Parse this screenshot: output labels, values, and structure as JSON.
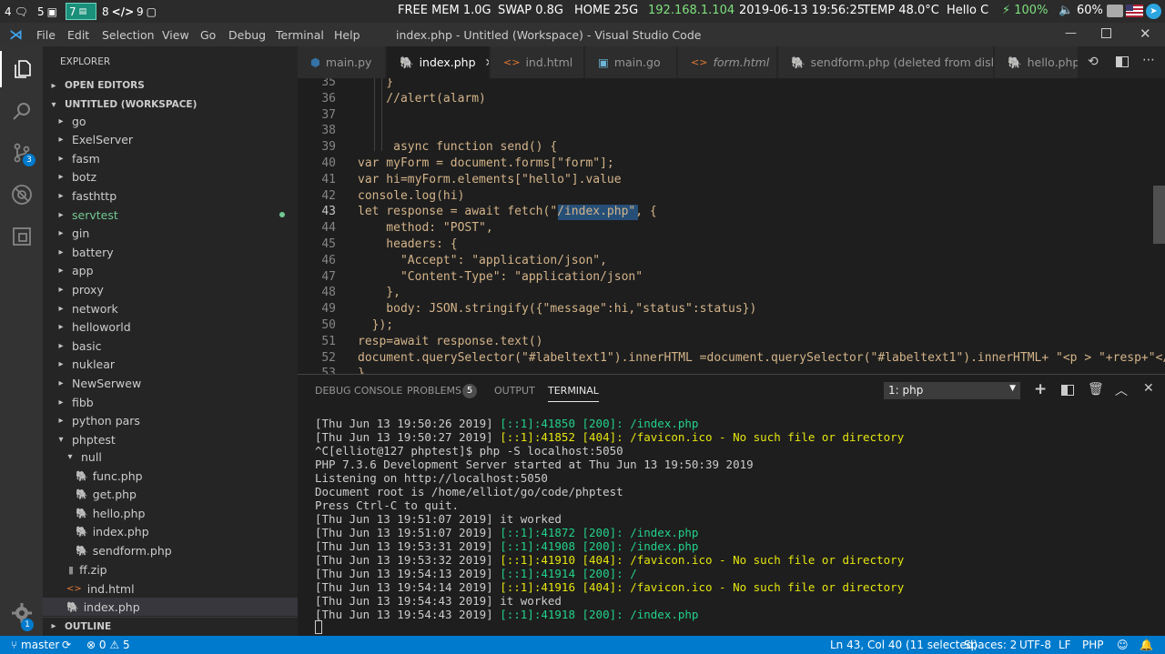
{
  "sysbar": {
    "workspaces": [
      "4",
      "5",
      "7",
      "8",
      "9"
    ],
    "free_mem": "FREE MEM 1.0G",
    "swap": "SWAP 0.8G",
    "home": "HOME 25G",
    "ip": "192.168.1.104",
    "datetime": "2019-06-13 19:56:25",
    "temp": "TEMP 48.0°C",
    "user": "Hello C",
    "battery": "⚡ 100%",
    "volume": "60%"
  },
  "titlebar": {
    "title": "index.php - Untitled (Workspace) - Visual Studio Code",
    "menu": [
      "File",
      "Edit",
      "Selection",
      "View",
      "Go",
      "Debug",
      "Terminal",
      "Help"
    ]
  },
  "activity": {
    "scm_badge": "3",
    "settings_badge": "1"
  },
  "sidebar": {
    "header": "EXPLORER",
    "open_editors": "OPEN EDITORS",
    "workspace": "UNTITLED (WORKSPACE)",
    "folders": [
      "go",
      "ExelServer",
      "fasm",
      "botz",
      "fasthttp",
      "servtest",
      "gin",
      "battery",
      "app",
      "proxy",
      "network",
      "helloworld",
      "basic",
      "nuklear",
      "NewSerwew",
      "fibb",
      "python pars",
      "phptest"
    ],
    "null_folder": "null",
    "null_files": [
      "func.php",
      "get.php",
      "hello.php",
      "index.php",
      "sendform.php"
    ],
    "other_files": [
      "ff.zip",
      "ind.html",
      "index.php"
    ],
    "outline": "OUTLINE"
  },
  "tabs": [
    "main.py",
    "index.php",
    "ind.html",
    "main.go",
    "form.html",
    "sendform.php (deleted from disk)",
    "hello.php"
  ],
  "code": {
    "line_numbers": [
      "35",
      "36",
      "37",
      "38",
      "39",
      "40",
      "41",
      "42",
      "43",
      "44",
      "45",
      "46",
      "47",
      "48",
      "49",
      "50",
      "51",
      "52",
      "53"
    ],
    "lines": [
      "    }",
      "    //alert(alarm)",
      "",
      "",
      "     async function send() {",
      "var myForm = document.forms[\"form\"];",
      "var hi=myForm.elements[\"hello\"].value",
      "console.log(hi)",
      "let response = await fetch(\"/index.php\", {",
      "    method: \"POST\",",
      "    headers: {",
      "      \"Accept\": \"application/json\",",
      "      \"Content-Type\": \"application/json\"",
      "    },",
      "    body: JSON.stringify({\"message\":hi,\"status\":status})",
      "  });",
      "resp=await response.text()",
      "document.querySelector(\"#labeltext1\").innerHTML =document.querySelector(\"#labeltext1\").innerHTML+ \"<p > \"+resp+\"</",
      "}"
    ]
  },
  "panel": {
    "tabs": [
      "DEBUG CONSOLE",
      "PROBLEMS",
      "OUTPUT",
      "TERMINAL"
    ],
    "problems_count": "5",
    "terminal_select": "1: php",
    "lines": [
      "[Thu Jun 13 19:50:26 2019] [::1]:41850 [200]: /index.php",
      "[Thu Jun 13 19:50:27 2019] [::1]:41852 [404]: /favicon.ico - No such file or directory",
      "^C[elliot@127 phptest]$ php -S localhost:5050",
      "PHP 7.3.6 Development Server started at Thu Jun 13 19:50:39 2019",
      "Listening on http://localhost:5050",
      "Document root is /home/elliot/go/code/phptest",
      "Press Ctrl-C to quit.",
      "[Thu Jun 13 19:51:07 2019] it worked",
      "[Thu Jun 13 19:51:07 2019] [::1]:41872 [200]: /index.php",
      "[Thu Jun 13 19:53:31 2019] [::1]:41908 [200]: /index.php",
      "[Thu Jun 13 19:53:32 2019] [::1]:41910 [404]: /favicon.ico - No such file or directory",
      "[Thu Jun 13 19:54:13 2019] [::1]:41914 [200]: /",
      "[Thu Jun 13 19:54:14 2019] [::1]:41916 [404]: /favicon.ico - No such file or directory",
      "[Thu Jun 13 19:54:43 2019] it worked",
      "[Thu Jun 13 19:54:43 2019] [::1]:41918 [200]: /index.php"
    ]
  },
  "status": {
    "branch": "master",
    "errors": "0",
    "warnings": "5",
    "position": "Ln 43, Col 40 (11 selected)",
    "spaces": "Spaces: 2",
    "encoding": "UTF-8",
    "eol": "LF",
    "language": "PHP"
  },
  "colors": {
    "accent": "#007acc",
    "ip": "#7ee07e",
    "ok": "#23d18b",
    "err": "#e5e510"
  }
}
